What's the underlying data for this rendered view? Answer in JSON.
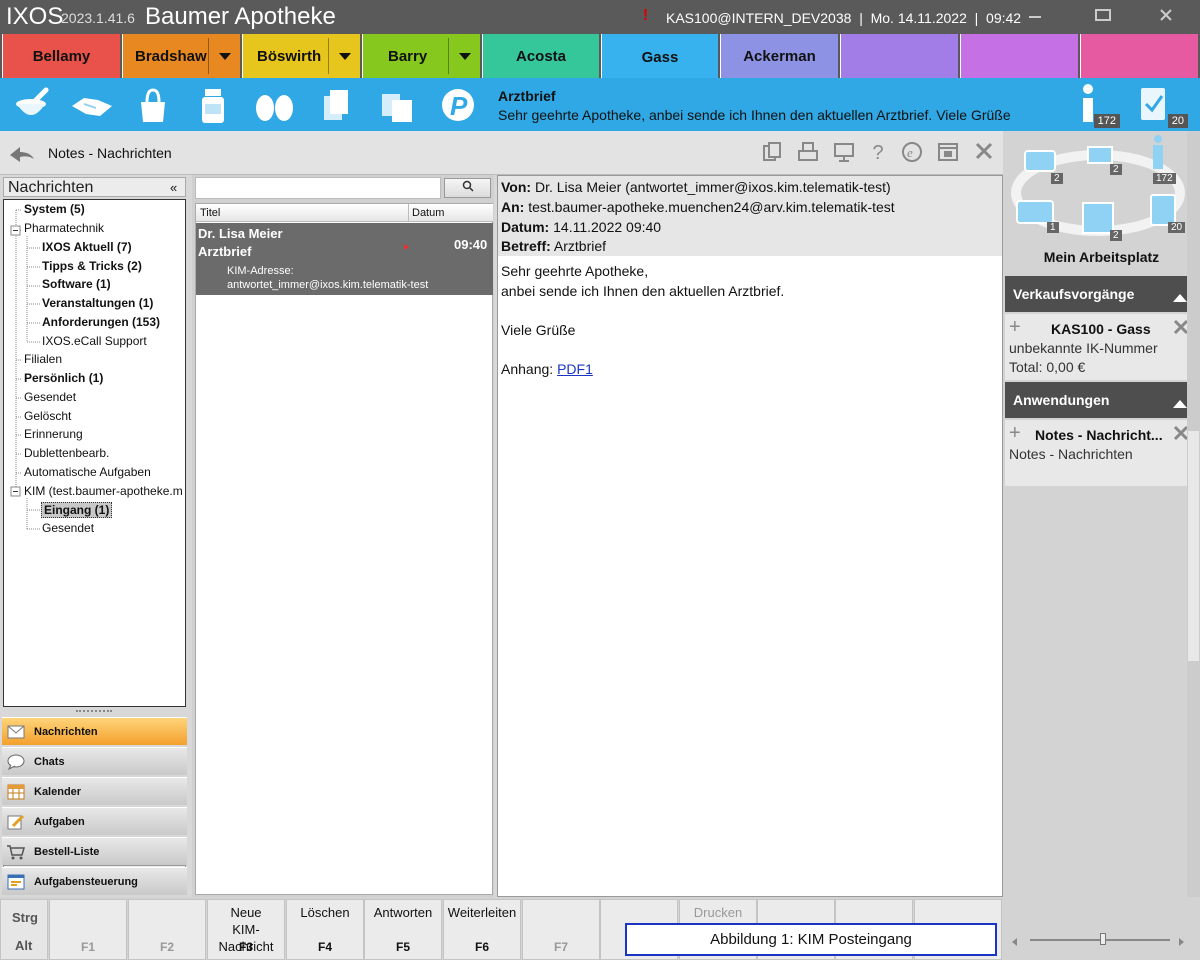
{
  "titlebar": {
    "app_name": "IXOS",
    "version": "2023.1.41.6",
    "pharmacy": "Baumer Apotheke",
    "session": "KAS100@INTERN_DEV2038  |  Mo. 14.11.2022  |  09:42",
    "warning_icon": "exclamation-shield-icon"
  },
  "tabs": [
    {
      "label": "Bellamy",
      "color": "#e8524a"
    },
    {
      "label": "Bradshaw",
      "color": "#e88820"
    },
    {
      "label": "Böswirth",
      "color": "#e6c51c"
    },
    {
      "label": "Barry",
      "color": "#86c81e"
    },
    {
      "label": "Acosta",
      "color": "#35c79a"
    },
    {
      "label": "Gass",
      "color": "#37b2ef"
    },
    {
      "label": "Ackerman",
      "color": "#8d92e4"
    },
    {
      "label": "",
      "color": "#a27de8"
    },
    {
      "label": "",
      "color": "#c570e4"
    },
    {
      "label": "",
      "color": "#e65aa1"
    }
  ],
  "toolbar": {
    "icons": [
      "mortar-icon",
      "handshake-icon",
      "shopping-bag-icon",
      "medicine-jar-icon",
      "baby-feet-icon",
      "documents-icon",
      "boxes-icon",
      "p-logo-icon"
    ],
    "msg_title": "Arztbrief",
    "msg_sub": "Sehr geehrte Apotheke, anbei sende ich Ihnen den aktuellen Arztbrief. Viele Grüße",
    "info_badge": "172",
    "tasks_badge": "20"
  },
  "header": {
    "title": "Notes - Nachrichten"
  },
  "left": {
    "title": "Nachrichten",
    "collapse": "«",
    "tree": [
      {
        "label": "System (5)",
        "bold": true
      },
      {
        "label": "Pharmatechnik",
        "bold": false
      },
      {
        "label": "IXOS Aktuell (7)",
        "bold": true
      },
      {
        "label": "Tipps & Tricks (2)",
        "bold": true
      },
      {
        "label": "Software (1)",
        "bold": true
      },
      {
        "label": "Veranstaltungen (1)",
        "bold": true
      },
      {
        "label": "Anforderungen (153)",
        "bold": true
      },
      {
        "label": "IXOS.eCall Support",
        "bold": false
      },
      {
        "label": "Filialen",
        "bold": false
      },
      {
        "label": "Persönlich (1)",
        "bold": true
      },
      {
        "label": "Gesendet",
        "bold": false
      },
      {
        "label": "Gelöscht",
        "bold": false
      },
      {
        "label": "Erinnerung",
        "bold": false
      },
      {
        "label": "Dublettenbearb.",
        "bold": false
      },
      {
        "label": "Automatische Aufgaben",
        "bold": false
      },
      {
        "label": "KIM (test.baumer-apotheke.m",
        "bold": false
      },
      {
        "label": "Eingang (1)",
        "bold": true
      },
      {
        "label": "Gesendet",
        "bold": false
      }
    ],
    "nav": [
      {
        "label": "Nachrichten",
        "icon": "envelope-icon"
      },
      {
        "label": "Chats",
        "icon": "chat-bubble-icon"
      },
      {
        "label": "Kalender",
        "icon": "calendar-icon"
      },
      {
        "label": "Aufgaben",
        "icon": "task-pencil-icon"
      },
      {
        "label": "Bestell-Liste",
        "icon": "cart-icon"
      },
      {
        "label": "Aufgabensteuerung",
        "icon": "task-control-icon"
      }
    ]
  },
  "list": {
    "col_title": "Titel",
    "col_date": "Datum",
    "row": {
      "sender": "Dr. Lisa Meier",
      "subject": "Arztbrief",
      "time": "09:40",
      "kim_label": "KIM-Adresse:",
      "kim_address": "antwortet_immer@ixos.kim.telematik-test"
    }
  },
  "message": {
    "from_label": "Von:",
    "from": "Dr. Lisa Meier (antwortet_immer@ixos.kim.telematik-test)",
    "to_label": "An:",
    "to": "test.baumer-apotheke.muenchen24@arv.kim.telematik-test",
    "date_label": "Datum:",
    "date": "14.11.2022 09:40",
    "subject_label": "Betreff:",
    "subject": "Arztbrief",
    "body1": "Sehr geehrte Apotheke,",
    "body2": "anbei sende ich Ihnen den aktuellen Arztbrief.",
    "body3": "Viele Grüße",
    "attachment_label": "Anhang:",
    "attachment": "PDF1"
  },
  "right": {
    "workspace_title": "Mein Arbeitsplatz",
    "badges": [
      "2",
      "2",
      "172",
      "1",
      "2",
      "20"
    ],
    "sales_header": "Verkaufsvorgänge",
    "sale_title": "KAS100 - Gass",
    "sale_line1": "unbekannte IK-Nummer",
    "sale_line2": "Total: 0,00 €",
    "apps_header": "Anwendungen",
    "app_title": "Notes - Nachricht...",
    "app_line1": "Notes - Nachrichten"
  },
  "fkeys": {
    "strg": "Strg",
    "alt": "Alt",
    "keys": [
      {
        "label": "",
        "key": "F1"
      },
      {
        "label": "",
        "key": "F2"
      },
      {
        "label": "Neue KIM-Nachricht",
        "key": "F3"
      },
      {
        "label": "Löschen",
        "key": "F4"
      },
      {
        "label": "Antworten",
        "key": "F5"
      },
      {
        "label": "Weiterleiten",
        "key": "F6"
      },
      {
        "label": "",
        "key": "F7"
      },
      {
        "label": "Drucken",
        "key": ""
      },
      {
        "label": "",
        "key": ""
      },
      {
        "label": "",
        "key": ""
      }
    ],
    "caption": "Abbildung 1: KIM Posteingang"
  }
}
